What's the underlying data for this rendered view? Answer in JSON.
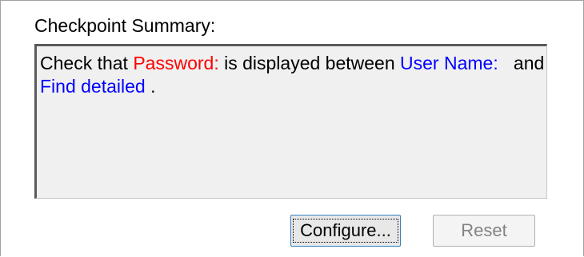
{
  "summary": {
    "label": "Checkpoint Summary:",
    "text": {
      "prefix": "Check that ",
      "field": "Password:",
      "middle": " is displayed between ",
      "before_object": "User Name:",
      "and_word": "   and",
      "after_object": "Find detailed",
      "end": " ."
    }
  },
  "buttons": {
    "configure_label": "Configure...",
    "reset_label": "Reset"
  },
  "colors": {
    "field_highlight": "#ff0000",
    "object_highlight": "#0000ff",
    "box_background": "#f0f0f0"
  }
}
